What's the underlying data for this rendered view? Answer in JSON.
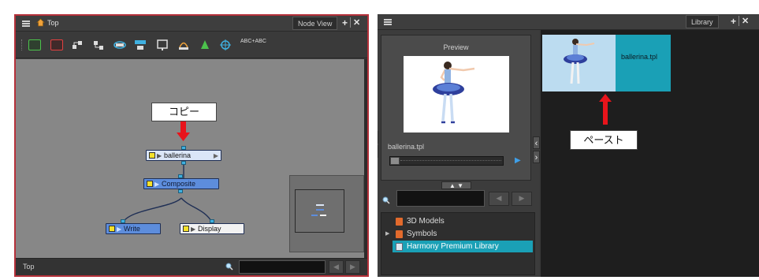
{
  "node_view": {
    "breadcrumb": "Top",
    "tab_label": "Node View",
    "add_symbol": "+",
    "close_symbol": "✕",
    "footer_label": "Top",
    "nodes": {
      "ballerina": "ballerina",
      "composite": "Composite",
      "write": "Write",
      "display": "Display"
    },
    "copy_callout": "コピー",
    "toolbar_text_icon": "ABC+ABC"
  },
  "library": {
    "tab_label": "Library",
    "add_symbol": "+",
    "close_symbol": "✕",
    "preview_title": "Preview",
    "preview_filename": "ballerina.tpl",
    "up_down": "▲ ▼",
    "tree": [
      {
        "label": "3D Models",
        "expandable": false,
        "selected": false
      },
      {
        "label": "Symbols",
        "expandable": true,
        "selected": false
      },
      {
        "label": "Harmony Premium Library",
        "expandable": false,
        "selected": true
      }
    ],
    "template_name": "ballerina.tpl",
    "paste_callout": "ペースト"
  },
  "colors": {
    "selection": "#1aa0b6",
    "highlight_border": "#b5313a",
    "callout_arrow": "#e8141b",
    "node_blue": "#5d8ddc",
    "node_light": "#dbe6f7"
  }
}
